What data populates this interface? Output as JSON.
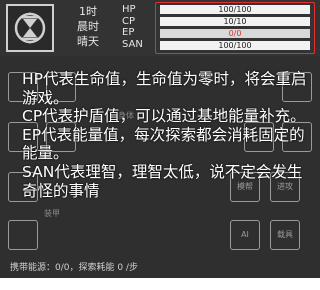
{
  "time": {
    "hour": "1时",
    "period": "晨时",
    "weather": "晴天"
  },
  "stats": [
    {
      "label": "HP",
      "text": "100/100",
      "fill": 1.0,
      "cls": "hp"
    },
    {
      "label": "CP",
      "text": "10/10",
      "fill": 1.0,
      "cls": "cp"
    },
    {
      "label": "EP",
      "text": "0/0",
      "fill": 0.0,
      "cls": "ep"
    },
    {
      "label": "SAN",
      "text": "100/100",
      "fill": 1.0,
      "cls": "san"
    }
  ],
  "tooltip": {
    "lines": [
      "HP代表生命值，生命值为零时，将会重启游戏。",
      "CP代表护盾值，可以通过基地能量补充。",
      "EP代表能量值，每次探索都会消耗固定的能量。",
      "SAN代表理智，理智太低，说不定会发生奇怪的事情"
    ]
  },
  "grid": {
    "section_labels": [
      "身体",
      "装甲"
    ],
    "cell_labels": [
      "模帮",
      "进攻",
      "AI",
      "载具"
    ]
  },
  "carry": {
    "text": "携带能源：0/0，探索耗能 0 /步"
  },
  "colors": {
    "ep_warning": "#e03030",
    "highlight_border": "#e03030"
  }
}
